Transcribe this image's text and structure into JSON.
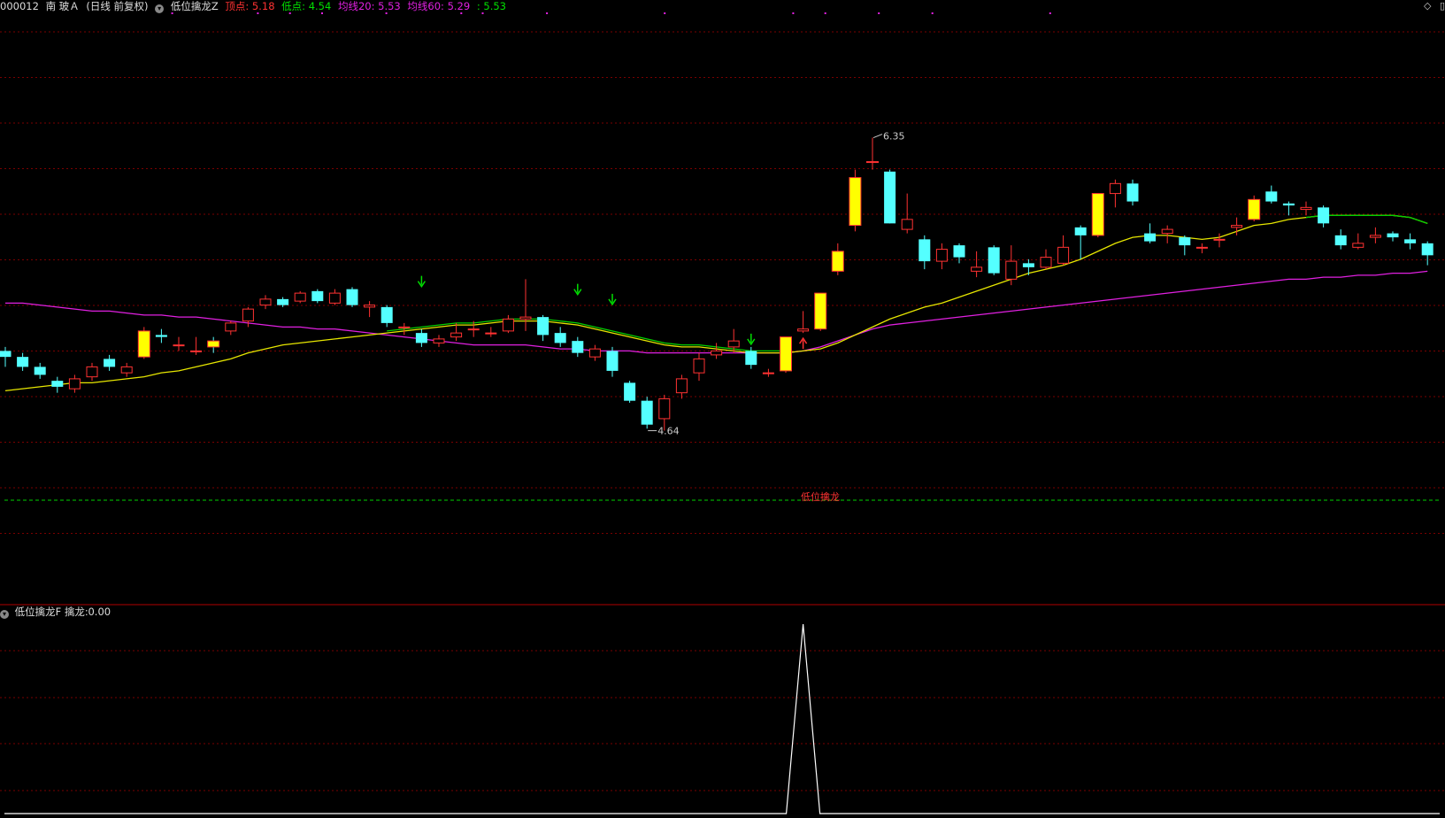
{
  "header": {
    "code": "000012",
    "name": "南 玻Ａ",
    "mode": "(日线 前复权)",
    "indicator": "低位擒龙Z",
    "top_label": "顶点:",
    "top_value": "5.18",
    "low_label": "低点:",
    "low_value": "4.54",
    "ma20_label": "均线20:",
    "ma20_value": "5.53",
    "ma60_label": "均线60:",
    "ma60_value": "5.29",
    "extra_value": ": 5.53",
    "right_icons": [
      "diamond-icon",
      "window-icon"
    ]
  },
  "annotations": {
    "high_label": "6.35",
    "low_label": "4.64",
    "signal_text": "低位擒龙"
  },
  "sub_panel": {
    "indicator": "低位擒龙F",
    "series_label": "擒龙:",
    "series_value": "0.00"
  },
  "colors": {
    "up": "#ff3232",
    "down": "#54ffff",
    "limit_up": "#ffff00",
    "ma20": "#e6e600",
    "ma20_alt": "#00d000",
    "ma60": "#e020e0",
    "grid": "#7a0000",
    "signal_line": "#00d000"
  },
  "chart_data": {
    "type": "candlestick",
    "price_range": [
      4.3,
      6.5
    ],
    "candles": [
      [
        5.28,
        5.25,
        5.3,
        5.2
      ],
      [
        5.25,
        5.2,
        5.27,
        5.18
      ],
      [
        5.2,
        5.16,
        5.22,
        5.14
      ],
      [
        5.13,
        5.1,
        5.15,
        5.07
      ],
      [
        5.09,
        5.14,
        5.16,
        5.07
      ],
      [
        5.15,
        5.2,
        5.22,
        5.13
      ],
      [
        5.24,
        5.2,
        5.26,
        5.18
      ],
      [
        5.17,
        5.2,
        5.22,
        5.15
      ],
      [
        5.25,
        5.38,
        5.4,
        5.24
      ],
      [
        5.36,
        5.35,
        5.39,
        5.32
      ],
      [
        5.31,
        5.31,
        5.35,
        5.28
      ],
      [
        5.28,
        5.28,
        5.35,
        5.26
      ],
      [
        5.33,
        5.3,
        5.35,
        5.27
      ],
      [
        5.38,
        5.42,
        5.43,
        5.36
      ],
      [
        5.43,
        5.49,
        5.5,
        5.4
      ],
      [
        5.51,
        5.54,
        5.56,
        5.49
      ],
      [
        5.54,
        5.51,
        5.55,
        5.5
      ],
      [
        5.53,
        5.57,
        5.58,
        5.52
      ],
      [
        5.58,
        5.53,
        5.59,
        5.52
      ],
      [
        5.52,
        5.57,
        5.59,
        5.51
      ],
      [
        5.59,
        5.51,
        5.6,
        5.5
      ],
      [
        5.5,
        5.51,
        5.53,
        5.45
      ],
      [
        5.5,
        5.42,
        5.51,
        5.4
      ],
      [
        5.4,
        5.4,
        5.42,
        5.36
      ],
      [
        5.37,
        5.32,
        5.39,
        5.3
      ],
      [
        5.32,
        5.34,
        5.36,
        5.3
      ],
      [
        5.35,
        5.37,
        5.42,
        5.33
      ],
      [
        5.39,
        5.39,
        5.43,
        5.35
      ],
      [
        5.37,
        5.37,
        5.4,
        5.35
      ],
      [
        5.38,
        5.44,
        5.46,
        5.37
      ],
      [
        5.44,
        5.45,
        5.64,
        5.38
      ],
      [
        5.45,
        5.36,
        5.46,
        5.33
      ],
      [
        5.37,
        5.32,
        5.4,
        5.3
      ],
      [
        5.33,
        5.27,
        5.35,
        5.25
      ],
      [
        5.25,
        5.29,
        5.31,
        5.23
      ],
      [
        5.28,
        5.18,
        5.3,
        5.15
      ],
      [
        5.12,
        5.03,
        5.13,
        5.02
      ],
      [
        5.03,
        4.91,
        5.05,
        4.89
      ],
      [
        4.94,
        5.04,
        5.06,
        4.88
      ],
      [
        5.07,
        5.14,
        5.16,
        5.04
      ],
      [
        5.17,
        5.24,
        5.27,
        5.13
      ],
      [
        5.26,
        5.28,
        5.32,
        5.24
      ],
      [
        5.3,
        5.33,
        5.39,
        5.27
      ],
      [
        5.28,
        5.21,
        5.3,
        5.19
      ],
      [
        5.17,
        5.17,
        5.19,
        5.15
      ],
      [
        5.18,
        5.35,
        5.35,
        5.17
      ],
      [
        5.38,
        5.39,
        5.48,
        5.37
      ],
      [
        5.39,
        5.57,
        5.57,
        5.38
      ],
      [
        5.68,
        5.78,
        5.82,
        5.66
      ],
      [
        5.91,
        6.15,
        6.19,
        5.88
      ],
      [
        6.23,
        6.23,
        6.35,
        6.19
      ],
      [
        6.18,
        5.92,
        6.19,
        5.92
      ],
      [
        5.89,
        5.94,
        6.07,
        5.87
      ],
      [
        5.84,
        5.73,
        5.86,
        5.69
      ],
      [
        5.73,
        5.79,
        5.82,
        5.69
      ],
      [
        5.81,
        5.75,
        5.82,
        5.72
      ],
      [
        5.68,
        5.7,
        5.78,
        5.65
      ],
      [
        5.8,
        5.67,
        5.81,
        5.66
      ],
      [
        5.64,
        5.73,
        5.81,
        5.61
      ],
      [
        5.72,
        5.7,
        5.74,
        5.66
      ],
      [
        5.7,
        5.75,
        5.79,
        5.69
      ],
      [
        5.72,
        5.8,
        5.86,
        5.71
      ],
      [
        5.9,
        5.86,
        5.91,
        5.74
      ],
      [
        5.86,
        6.07,
        6.07,
        5.85
      ],
      [
        6.07,
        6.12,
        6.14,
        6.0
      ],
      [
        6.12,
        6.03,
        6.14,
        6.01
      ],
      [
        5.87,
        5.83,
        5.92,
        5.82
      ],
      [
        5.87,
        5.89,
        5.91,
        5.82
      ],
      [
        5.85,
        5.81,
        5.86,
        5.76
      ],
      [
        5.8,
        5.8,
        5.82,
        5.77
      ],
      [
        5.84,
        5.84,
        5.87,
        5.8
      ],
      [
        5.9,
        5.91,
        5.95,
        5.86
      ],
      [
        5.94,
        6.04,
        6.06,
        5.93
      ],
      [
        6.08,
        6.03,
        6.11,
        6.02
      ],
      [
        6.02,
        6.01,
        6.03,
        5.96
      ],
      [
        5.99,
        6.0,
        6.03,
        5.96
      ],
      [
        6.0,
        5.92,
        6.01,
        5.9
      ],
      [
        5.86,
        5.81,
        5.89,
        5.79
      ],
      [
        5.8,
        5.82,
        5.87,
        5.79
      ],
      [
        5.85,
        5.86,
        5.9,
        5.82
      ],
      [
        5.87,
        5.85,
        5.88,
        5.83
      ],
      [
        5.84,
        5.82,
        5.87,
        5.79
      ],
      [
        5.82,
        5.76,
        5.83,
        5.71
      ]
    ],
    "ma20": [
      5.08,
      5.09,
      5.1,
      5.11,
      5.12,
      5.12,
      5.13,
      5.14,
      5.15,
      5.17,
      5.18,
      5.2,
      5.22,
      5.24,
      5.27,
      5.29,
      5.31,
      5.32,
      5.33,
      5.34,
      5.35,
      5.36,
      5.37,
      5.38,
      5.39,
      5.4,
      5.41,
      5.41,
      5.42,
      5.43,
      5.43,
      5.43,
      5.42,
      5.41,
      5.39,
      5.37,
      5.35,
      5.33,
      5.31,
      5.3,
      5.3,
      5.29,
      5.28,
      5.27,
      5.27,
      5.27,
      5.28,
      5.29,
      5.32,
      5.36,
      5.4,
      5.44,
      5.47,
      5.5,
      5.52,
      5.55,
      5.58,
      5.61,
      5.64,
      5.67,
      5.69,
      5.71,
      5.74,
      5.78,
      5.82,
      5.85,
      5.86,
      5.86,
      5.85,
      5.84,
      5.85,
      5.88,
      5.91,
      5.92,
      5.94,
      5.95,
      5.96,
      5.96,
      5.96,
      5.96,
      5.96,
      5.95,
      5.92
    ],
    "ma60": [
      5.52,
      5.52,
      5.51,
      5.5,
      5.49,
      5.48,
      5.48,
      5.47,
      5.46,
      5.46,
      5.45,
      5.45,
      5.44,
      5.43,
      5.42,
      5.41,
      5.4,
      5.4,
      5.39,
      5.39,
      5.38,
      5.37,
      5.36,
      5.35,
      5.34,
      5.33,
      5.32,
      5.31,
      5.31,
      5.31,
      5.31,
      5.3,
      5.29,
      5.29,
      5.28,
      5.28,
      5.28,
      5.27,
      5.27,
      5.27,
      5.27,
      5.27,
      5.27,
      5.27,
      5.27,
      5.27,
      5.28,
      5.3,
      5.33,
      5.36,
      5.39,
      5.41,
      5.42,
      5.43,
      5.44,
      5.45,
      5.46,
      5.47,
      5.48,
      5.49,
      5.5,
      5.51,
      5.52,
      5.53,
      5.54,
      5.55,
      5.56,
      5.57,
      5.58,
      5.59,
      5.6,
      5.61,
      5.62,
      5.63,
      5.64,
      5.64,
      5.65,
      5.65,
      5.66,
      5.66,
      5.67,
      5.67,
      5.68
    ],
    "down_arrows": [
      24,
      33,
      35,
      43
    ],
    "up_arrows": [
      46
    ],
    "limit_up_days": [
      8,
      12,
      45,
      47,
      48,
      49,
      50,
      63,
      72
    ],
    "signal_index": 46,
    "sub_series": {
      "name": "擒龙",
      "peak_index": 46,
      "peak_value": 1
    }
  }
}
